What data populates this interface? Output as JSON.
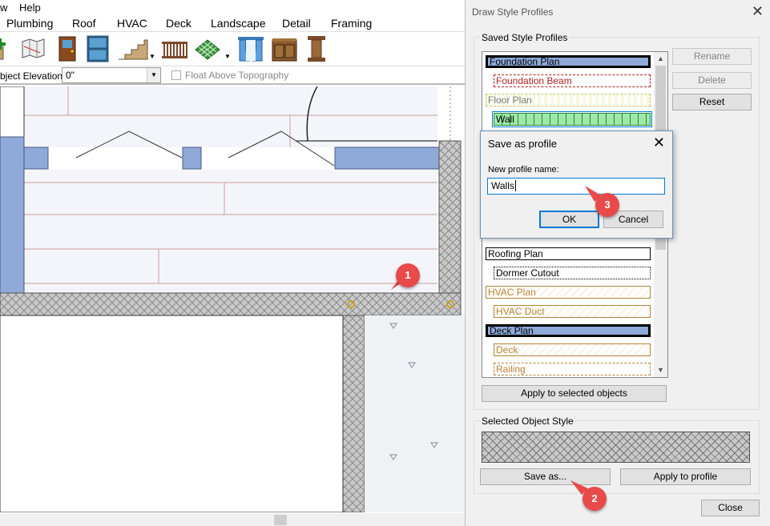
{
  "app": {
    "menu_top": [
      "w",
      "Help"
    ],
    "menu_main": [
      "Plumbing",
      "Roof",
      "HVAC",
      "Deck",
      "Landscape",
      "Detail",
      "Framing"
    ],
    "toolbar_icons": [
      "add-plant-icon",
      "map-icon",
      "door-icon",
      "window-icon",
      "stairs-icon",
      "railing-icon",
      "lattice-icon",
      "curtains-icon",
      "cabinet-icon",
      "column-icon"
    ],
    "elevation_label": "bject Elevation:",
    "elevation_value": "0\"",
    "float_label": "Float Above Topography"
  },
  "callouts": [
    "1",
    "2",
    "3"
  ],
  "draw_style_profiles": {
    "title": "Draw Style Profiles",
    "saved_group_label": "Saved Style Profiles",
    "profiles": [
      {
        "label": "Foundation Plan",
        "color": "#000000"
      },
      {
        "label": "Foundation Beam",
        "color": "#b22222"
      },
      {
        "label": "Floor Plan",
        "color": "#7a7a7a"
      },
      {
        "label": "Wall",
        "color": "#000000"
      },
      {
        "label": "Roofing Plan",
        "color": "#000000"
      },
      {
        "label": "Dormer Cutout",
        "color": "#000000"
      },
      {
        "label": "HVAC Plan",
        "color": "#b8843a"
      },
      {
        "label": "HVAC Duct",
        "color": "#b8843a"
      },
      {
        "label": "Deck Plan",
        "color": "#000000"
      },
      {
        "label": "Deck",
        "color": "#b8843a"
      },
      {
        "label": "Railing",
        "color": "#b8843a"
      }
    ],
    "rename_label": "Rename",
    "delete_label": "Delete",
    "reset_label": "Reset",
    "apply_selected_label": "Apply to selected objects",
    "selected_group_label": "Selected Object Style",
    "save_as_label": "Save as...",
    "apply_profile_label": "Apply to profile",
    "close_label": "Close"
  },
  "save_dialog": {
    "title": "Save as profile",
    "field_label": "New profile name:",
    "field_value": "Walls",
    "ok_label": "OK",
    "cancel_label": "Cancel"
  }
}
